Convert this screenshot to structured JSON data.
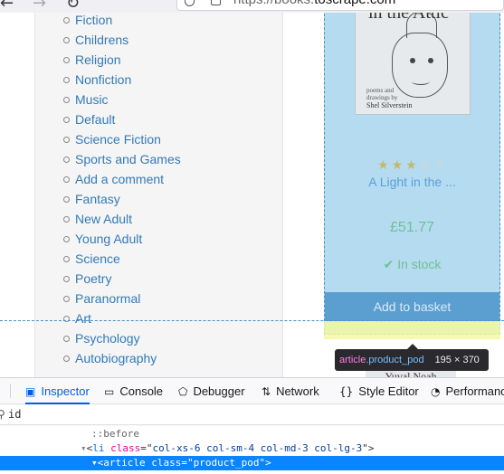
{
  "browser": {
    "url_prefix": "https://books.",
    "url_domain": "toscrape.com"
  },
  "sidebar": {
    "categories": [
      "Fiction",
      "Childrens",
      "Religion",
      "Nonfiction",
      "Music",
      "Default",
      "Science Fiction",
      "Sports and Games",
      "Add a comment",
      "Fantasy",
      "New Adult",
      "Young Adult",
      "Science",
      "Poetry",
      "Paranormal",
      "Art",
      "Psychology",
      "Autobiography"
    ]
  },
  "product": {
    "cover_title": "in the Attic",
    "cover_credit": "poems and drawings by",
    "cover_author": "Shel Silverstein",
    "rating": 3,
    "rating_max": 5,
    "title": "A Light in the ...",
    "price": "£51.77",
    "stock": "In stock",
    "basket_button": "Add to basket",
    "next_author": "Yuval Noah"
  },
  "inspector_tooltip": {
    "tag": "article",
    "class": ".product_pod",
    "dimensions": "195 × 370"
  },
  "devtools": {
    "tabs": [
      {
        "label": "Inspector",
        "icon": "inspector-icon",
        "active": true
      },
      {
        "label": "Console",
        "icon": "console-icon",
        "active": false
      },
      {
        "label": "Debugger",
        "icon": "debugger-icon",
        "active": false
      },
      {
        "label": "Network",
        "icon": "network-icon",
        "active": false
      },
      {
        "label": "Style Editor",
        "icon": "style-editor-icon",
        "active": false
      },
      {
        "label": "Performance",
        "icon": "performance-icon",
        "active": false
      }
    ],
    "search_value": "id",
    "markup": {
      "pseudo": "::before",
      "li_tag": "li",
      "li_attr": "class",
      "li_val": "col-xs-6 col-sm-4 col-md-3 col-lg-3",
      "article_tag": "article",
      "article_attr": "class",
      "article_val": "product_pod"
    }
  },
  "colors": {
    "link": "#337ab7",
    "accent_selection": "#0a84ff",
    "highlight_content": "#78bee6",
    "highlight_padding": "#f4f8a0"
  }
}
